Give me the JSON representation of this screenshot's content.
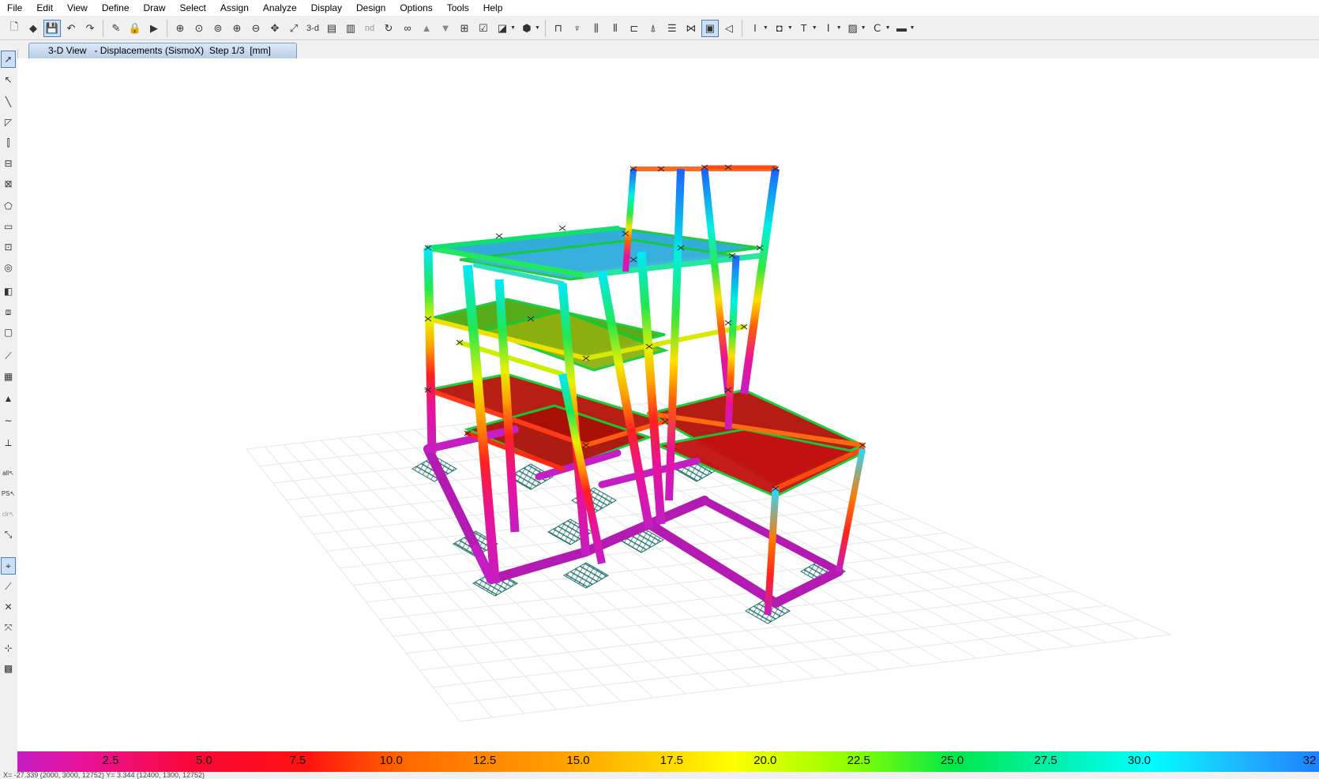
{
  "menu": [
    "File",
    "Edit",
    "View",
    "Define",
    "Draw",
    "Select",
    "Assign",
    "Analyze",
    "Display",
    "Design",
    "Options",
    "Tools",
    "Help"
  ],
  "toolbar": {
    "text_3d": "3-d",
    "text_nd": "nd"
  },
  "tab": {
    "title": "3-D View   - Displacements (SismoX)  Step 1/3  [mm]"
  },
  "left_toolbar": {
    "label_all": "all",
    "label_ps": "PS",
    "label_clr": "clr"
  },
  "legend": {
    "ticks": [
      "2.5",
      "5.0",
      "7.5",
      "10.0",
      "12.5",
      "15.0",
      "17.5",
      "20.0",
      "22.5",
      "25.0",
      "27.5",
      "30.0",
      "32"
    ]
  },
  "status": {
    "text": "X=  -27.339  (2000, 3000, 12752)  Y=  3.344   (12400, 1300, 12752)"
  },
  "colors": {
    "accent": "#4a7ebf",
    "base_magenta": "#c41ec4",
    "slab_red": "#b41408",
    "roof_blue": "#1f7fff"
  }
}
